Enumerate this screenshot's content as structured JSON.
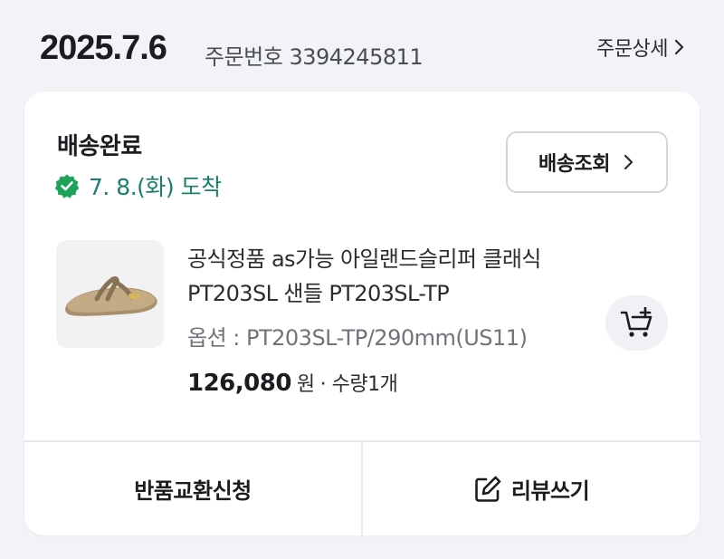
{
  "order": {
    "date": "2025.7.6",
    "number_label": "주문번호 3394245811",
    "detail_link": "주문상세"
  },
  "delivery": {
    "status": "배송완료",
    "arrival": "7. 8.(화) 도착",
    "track_button": "배송조회"
  },
  "product": {
    "name": "공식정품 as가능 아일랜드슬리퍼 클래식 PT203SL 샌들 PT203SL-TP",
    "option": "옵션 : PT203SL-TP/290mm(US11)",
    "price": "126,080",
    "price_unit": "원",
    "quantity": "· 수량1개"
  },
  "actions": {
    "return_exchange": "반품교환신청",
    "review": "리뷰쓰기"
  },
  "icons": {
    "detail_chevron": "chevron-right-icon",
    "verified": "check-badge-icon",
    "track_chevron": "chevron-right-icon",
    "cart_add": "cart-plus-icon",
    "review_edit": "edit-icon"
  },
  "colors": {
    "accent_green": "#1b7f6e",
    "badge_green": "#1fa35a",
    "background": "#f2f3f6"
  }
}
